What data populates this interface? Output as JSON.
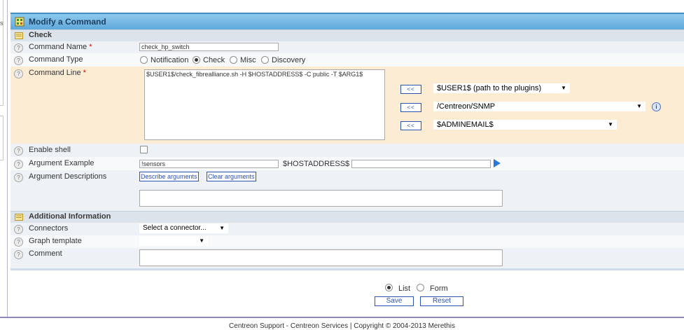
{
  "page": {
    "title": "Modify a Command"
  },
  "sections": {
    "check": "Check",
    "additional": "Additional Information"
  },
  "fields": {
    "command_name": {
      "label": "Command Name",
      "required": "*",
      "value": "check_hp_switch"
    },
    "command_type": {
      "label": "Command Type",
      "options": [
        "Notification",
        "Check",
        "Misc",
        "Discovery"
      ],
      "selected": "Check"
    },
    "command_line": {
      "label": "Command Line",
      "required": "*",
      "value": "$USER1$/check_fibrealliance.sh -H $HOSTADDRESS$ -C public -T $ARG1$"
    },
    "macros": {
      "insert_label": "<<",
      "select1": "$USER1$ (path to the plugins)",
      "select2": "/Centreon/SNMP",
      "select3": "$ADMINEMAIL$"
    },
    "enable_shell": {
      "label": "Enable shell",
      "checked": false
    },
    "argument_example": {
      "label": "Argument Example",
      "value": "!sensors",
      "macro_label": "$HOSTADDRESS$",
      "macro_value": ""
    },
    "argument_descriptions": {
      "label": "Argument Descriptions",
      "describe_button": "Describe arguments",
      "clear_button": "Clear arguments",
      "value": ""
    },
    "connectors": {
      "label": "Connectors",
      "value": "Select a connector..."
    },
    "graph_template": {
      "label": "Graph template",
      "value": ""
    },
    "comment": {
      "label": "Comment",
      "value": ""
    }
  },
  "icons": {
    "help": "help-icon",
    "title": "commands-icon",
    "section": "notepad-icon",
    "info": "info-icon",
    "play": "play-icon"
  },
  "form_actions": {
    "mode_options": [
      "List",
      "Form"
    ],
    "mode_selected": "List",
    "save_label": "Save",
    "reset_label": "Reset"
  },
  "footer": {
    "text": "Centreon Support - Centreon Services | Copyright © 2004-2013 Merethis"
  },
  "colors": {
    "title_bar": "#5fa9da",
    "accent_blue": "#2b53b3",
    "command_line_bg": "#fcecd4",
    "required": "#dd0000"
  }
}
